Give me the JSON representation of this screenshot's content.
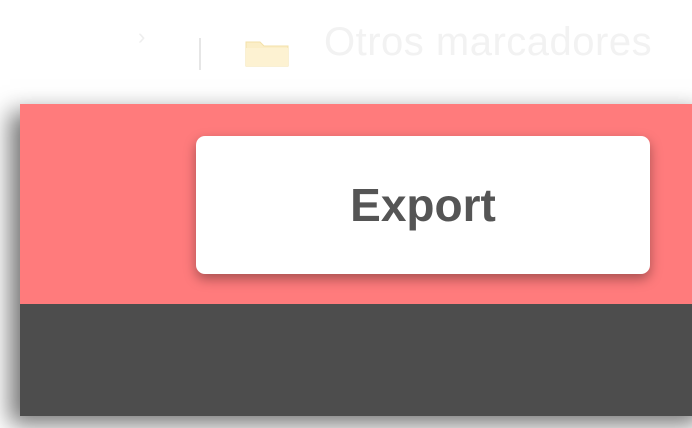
{
  "bookmarks_bar": {
    "folder_label": "Otros marcadores",
    "folder_icon": "folder-icon",
    "overflow_icon": "chevron-right-icon"
  },
  "panel": {
    "export_label": "Export",
    "colors": {
      "header": "#ff7b7c",
      "body": "#4d4d4d",
      "button": "#ffffff",
      "button_text": "#555555"
    }
  }
}
